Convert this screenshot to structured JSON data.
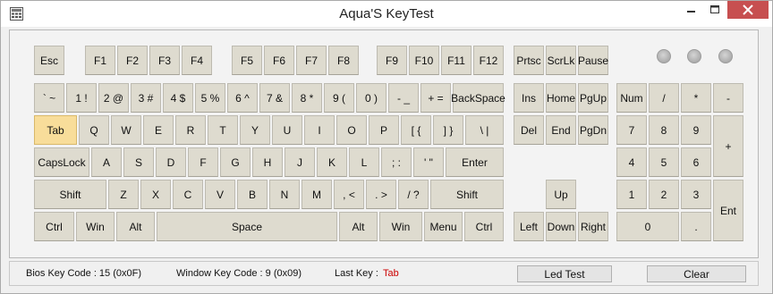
{
  "window": {
    "title": "Aqua'S KeyTest"
  },
  "icons": {
    "app": "keyboard-app-icon",
    "minimize": "minimize-icon",
    "maximize": "maximize-icon",
    "close": "close-icon"
  },
  "colors": {
    "key_face": "#dedbcf",
    "key_pressed": "#f8dd9a",
    "last_key_value": "#cc0000",
    "close_button": "#c74f50"
  },
  "keys": {
    "esc": "Esc",
    "f1": "F1",
    "f2": "F2",
    "f3": "F3",
    "f4": "F4",
    "f5": "F5",
    "f6": "F6",
    "f7": "F7",
    "f8": "F8",
    "f9": "F9",
    "f10": "F10",
    "f11": "F11",
    "f12": "F12",
    "prtsc": "Prtsc",
    "scrlk": "ScrLk",
    "pause": "Pause",
    "backtick": "` ~",
    "d1": "1 !",
    "d2": "2 @",
    "d3": "3 #",
    "d4": "4 $",
    "d5": "5 %",
    "d6": "6 ^",
    "d7": "7 &",
    "d8": "8 *",
    "d9": "9 (",
    "d0": "0 )",
    "minus": "- _",
    "equals": "+ =",
    "backspace": "BackSpace",
    "ins": "Ins",
    "home": "Home",
    "pgup": "PgUp",
    "num": "Num",
    "np_div": "/",
    "np_mul": "*",
    "np_sub": "-",
    "tab": "Tab",
    "q": "Q",
    "w": "W",
    "e": "E",
    "r": "R",
    "t": "T",
    "y": "Y",
    "u": "U",
    "i": "I",
    "o": "O",
    "p": "P",
    "lbracket": "[ {",
    "rbracket": "] }",
    "backslash": "\\ |",
    "del": "Del",
    "end": "End",
    "pgdn": "PgDn",
    "np7": "7",
    "np8": "8",
    "np9": "9",
    "np_add": "+",
    "capslock": "CapsLock",
    "a": "A",
    "s": "S",
    "d": "D",
    "f": "F",
    "g": "G",
    "h": "H",
    "j": "J",
    "k": "K",
    "l": "L",
    "semicolon": "; :",
    "quote": "' \"",
    "enter": "Enter",
    "np4": "4",
    "np5": "5",
    "np6": "6",
    "lshift": "Shift",
    "z": "Z",
    "x": "X",
    "c": "C",
    "v": "V",
    "b": "B",
    "n": "N",
    "m": "M",
    "comma": ", <",
    "period": ". >",
    "slash": "/ ?",
    "rshift": "Shift",
    "up": "Up",
    "np1": "1",
    "np2": "2",
    "np3": "3",
    "np_enter": "Ent",
    "lctrl": "Ctrl",
    "lwin": "Win",
    "lalt": "Alt",
    "space": "Space",
    "ralt": "Alt",
    "rwin": "Win",
    "menu": "Menu",
    "rctrl": "Ctrl",
    "left": "Left",
    "down": "Down",
    "right": "Right",
    "np0": "0",
    "np_dot": "."
  },
  "pressed_key": "Tab",
  "status": {
    "bios_label": "Bios Key Code : 15 (0x0F)",
    "window_label": "Window Key Code : 9 (0x09)",
    "last_key_label": "Last Key :",
    "last_key_value": "Tab"
  },
  "buttons": {
    "led_test": "Led Test",
    "clear": "Clear"
  }
}
